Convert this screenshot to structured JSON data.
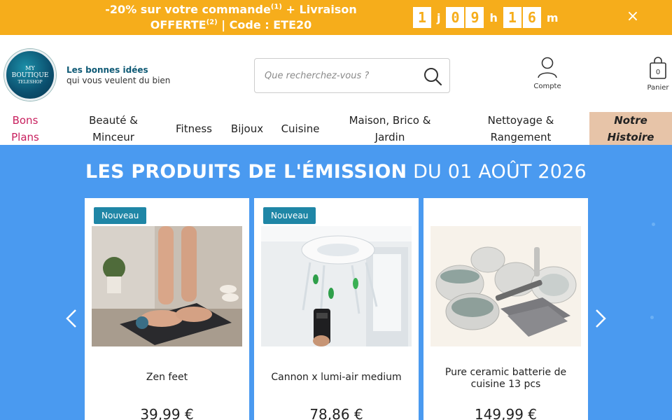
{
  "promo": {
    "text_part1": "-20% sur votre commande",
    "sup1": "(1)",
    "text_part2": " + Livraison OFFERTE",
    "sup2": "(2)",
    "text_part3": " | Code : ETE20",
    "countdown": {
      "days": "1",
      "days_unit": "j",
      "hours_tens": "0",
      "hours_ones": "9",
      "hours_unit": "h",
      "minutes_tens": "1",
      "minutes_ones": "6",
      "minutes_unit": "m"
    },
    "close_symbol": "×"
  },
  "header": {
    "logo": {
      "line1": "MY",
      "line2": "BOUTIQUE",
      "line3": "TELESHOP"
    },
    "tagline_line1": "Les bonnes idées",
    "tagline_line2": "qui vous veulent du bien",
    "search_placeholder": "Que recherchez-vous ?",
    "account_label": "Compte",
    "cart_label": "Panier",
    "cart_count": "0"
  },
  "nav": {
    "items": [
      {
        "label": "Bons Plans"
      },
      {
        "label": "Beauté & Minceur"
      },
      {
        "label": "Fitness"
      },
      {
        "label": "Bijoux"
      },
      {
        "label": "Cuisine"
      },
      {
        "label": "Maison, Brico & Jardin"
      },
      {
        "label": "Nettoyage & Rangement"
      },
      {
        "label": "Notre Histoire"
      }
    ]
  },
  "hero": {
    "title_strong": "LES PRODUITS DE L'ÉMISSION",
    "title_rest": " DU 01 AOÛT 2026",
    "products": [
      {
        "badge": "Nouveau",
        "name": "Zen feet",
        "price": "39,99 €"
      },
      {
        "badge": "Nouveau",
        "name": "Cannon x lumi-air medium",
        "price": "78,86 €"
      },
      {
        "badge": "",
        "name": "Pure ceramic batterie de cuisine 13 pcs",
        "price": "149,99 €"
      }
    ]
  },
  "colors": {
    "promo_bg": "#f6ad1b",
    "hero_bg": "#4a9af0",
    "badge_bg": "#1f86a6",
    "deals_text": "#c8205e",
    "story_bg": "#e7c4a8"
  }
}
